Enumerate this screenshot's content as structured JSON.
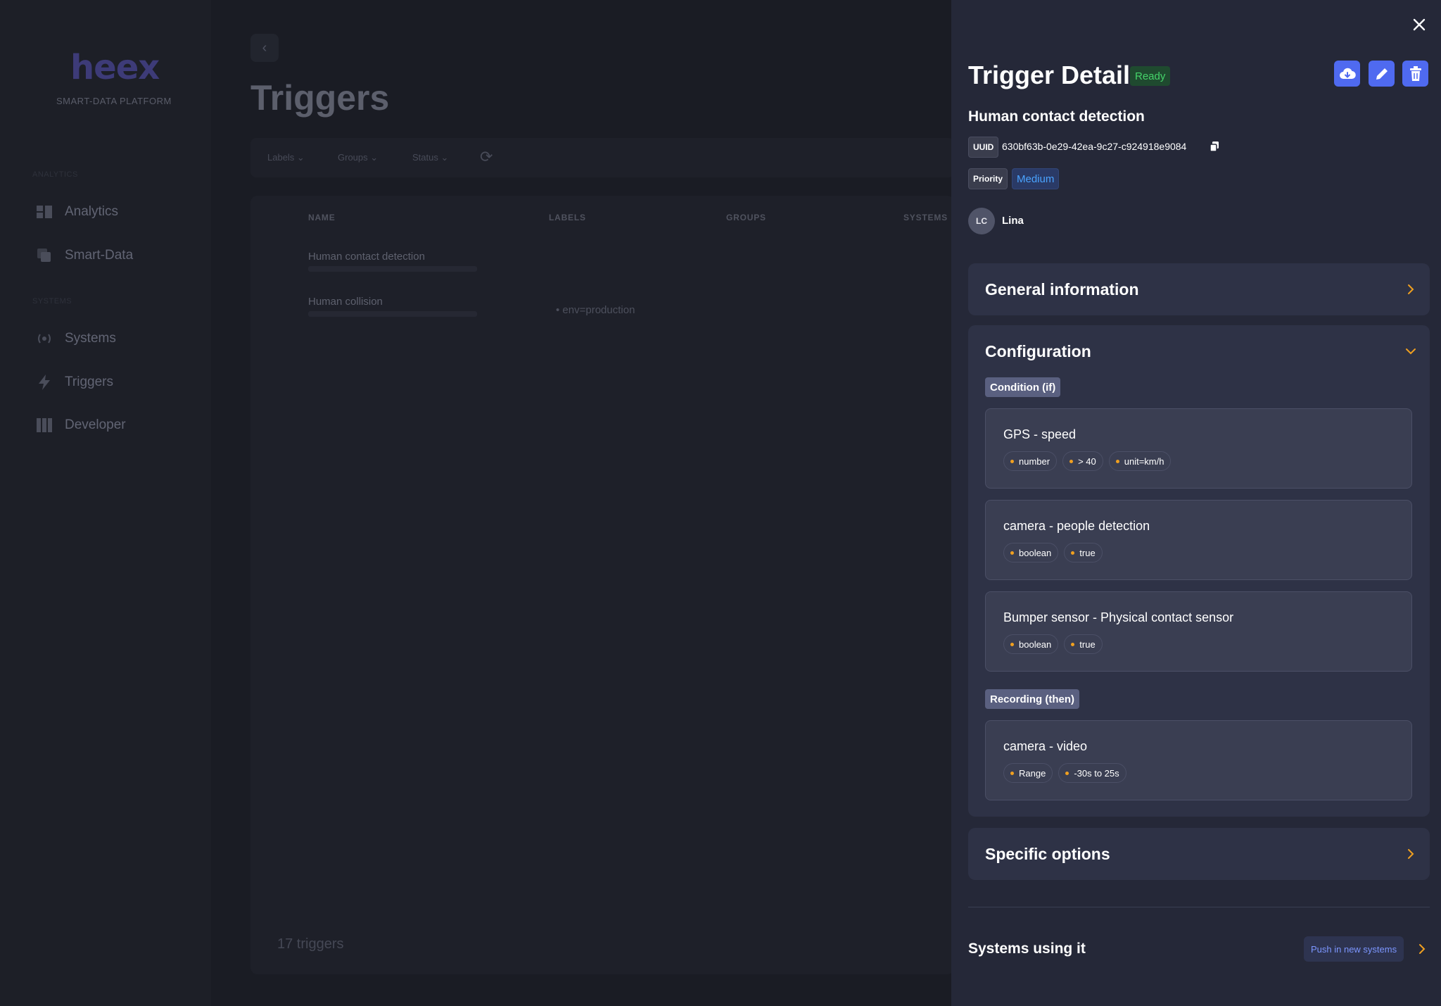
{
  "app": {
    "logo": "heex",
    "logo_subtitle": "SMART-DATA PLATFORM",
    "sidebar": {
      "section_1": "ANALYTICS",
      "section_2": "SYSTEMS",
      "items": [
        {
          "label": "Analytics",
          "icon": "analytics-icon"
        },
        {
          "label": "Smart-Data",
          "icon": "smart-data-icon"
        },
        {
          "label": "Systems",
          "icon": "systems-icon"
        },
        {
          "label": "Triggers",
          "icon": "triggers-icon"
        },
        {
          "label": "Developer",
          "icon": "developer-icon"
        }
      ]
    },
    "page_title": "Triggers",
    "filters": [
      "Labels",
      "Groups",
      "Status"
    ],
    "table": {
      "headers": [
        "NAME",
        "LABELS",
        "GROUPS",
        "SYSTEMS"
      ],
      "rows": [
        {
          "name": "Human contact detection",
          "label": ""
        },
        {
          "name": "Human collision",
          "label": "env=production"
        }
      ]
    },
    "count": "17 triggers"
  },
  "drawer": {
    "title": "Trigger Detail",
    "status": "Ready",
    "colors": {
      "accent": "#4f6af0",
      "ready_bg": "#1f4a2f",
      "ready_text": "#45d36a",
      "dot": "#f0a020"
    },
    "name": "Human contact detection",
    "uuid_label": "UUID",
    "uuid": "630bf63b-0e29-42ea-9c27-c924918e9084",
    "priority_label": "Priority",
    "priority": "Medium",
    "owner_initials": "LC",
    "owner": "Lina",
    "general_title": "General information",
    "configuration": {
      "title": "Configuration",
      "condition_tag": "Condition (if)",
      "conditions": [
        {
          "title": "GPS - speed",
          "chips": [
            "number",
            "> 40",
            "unit=km/h"
          ]
        },
        {
          "title": "camera - people detection",
          "chips": [
            "boolean",
            "true"
          ]
        },
        {
          "title": "Bumper sensor - Physical contact sensor",
          "chips": [
            "boolean",
            "true"
          ]
        }
      ],
      "recording_tag": "Recording (then)",
      "recordings": [
        {
          "title": "camera - video",
          "chips": [
            "Range",
            "-30s to 25s"
          ]
        }
      ]
    },
    "specific_title": "Specific options",
    "systems_title": "Systems using it",
    "push_button": "Push in new systems"
  }
}
